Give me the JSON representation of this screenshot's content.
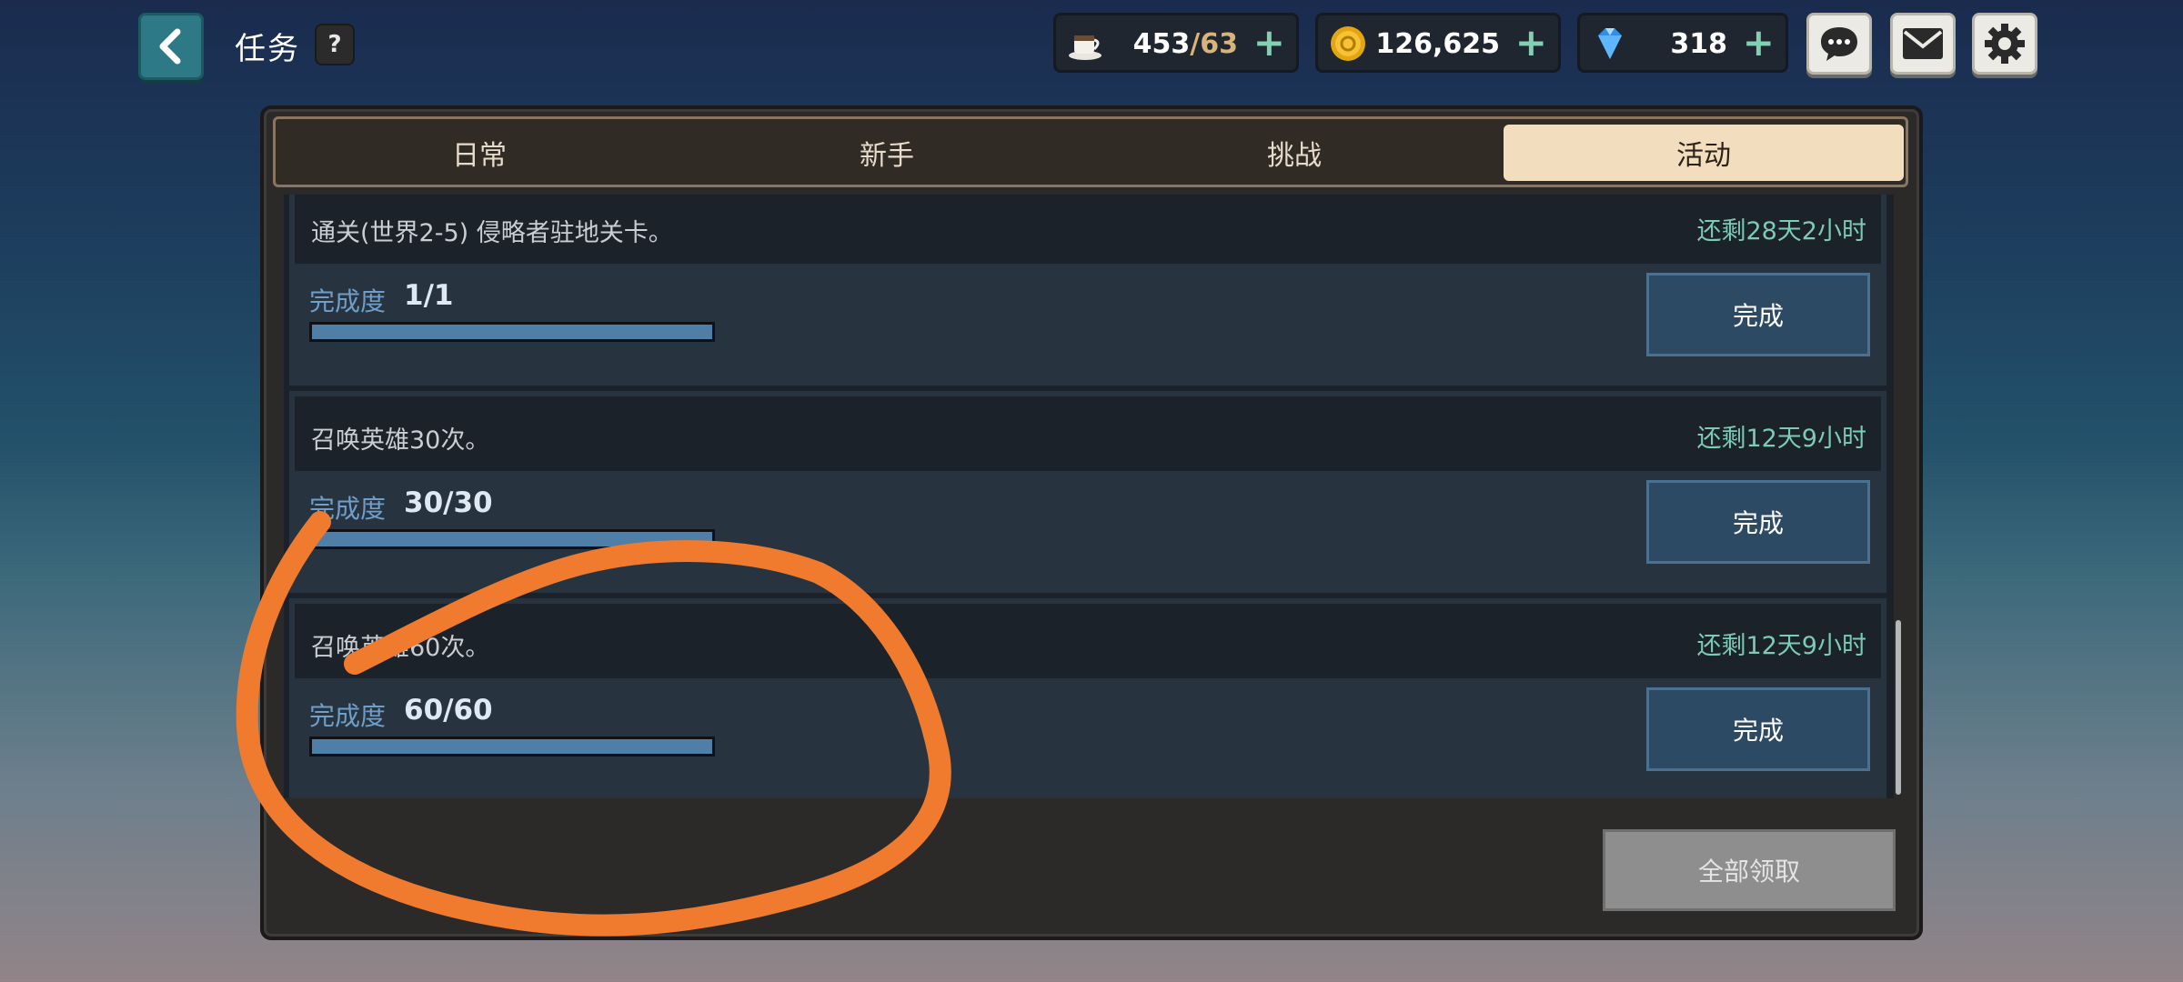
{
  "header": {
    "title": "任务",
    "help_label": "?"
  },
  "resources": {
    "stamina": {
      "current": "453",
      "max": "/63"
    },
    "gold": {
      "value": "126,625"
    },
    "gems": {
      "value": "318"
    },
    "plus": "+"
  },
  "tabs": [
    {
      "label": "日常",
      "active": false
    },
    {
      "label": "新手",
      "active": false
    },
    {
      "label": "挑战",
      "active": false
    },
    {
      "label": "活动",
      "active": true
    }
  ],
  "tasks": [
    {
      "desc": "通关(世界2-5) 侵略者驻地关卡。",
      "time": "还剩28天2小时",
      "progress_label": "完成度",
      "progress": "1/1",
      "fraction": 1.0,
      "button": "完成"
    },
    {
      "desc": "召唤英雄30次。",
      "time": "还剩12天9小时",
      "progress_label": "完成度",
      "progress": "30/30",
      "fraction": 1.0,
      "button": "完成"
    },
    {
      "desc": "召唤英雄60次。",
      "time": "还剩12天9小时",
      "progress_label": "完成度",
      "progress": "60/60",
      "fraction": 1.0,
      "button": "完成"
    }
  ],
  "claim_all": "全部领取",
  "colors": {
    "accent": "#2d7a86",
    "annotation": "#f07a2e",
    "active_tab": "#f3ddbf"
  }
}
